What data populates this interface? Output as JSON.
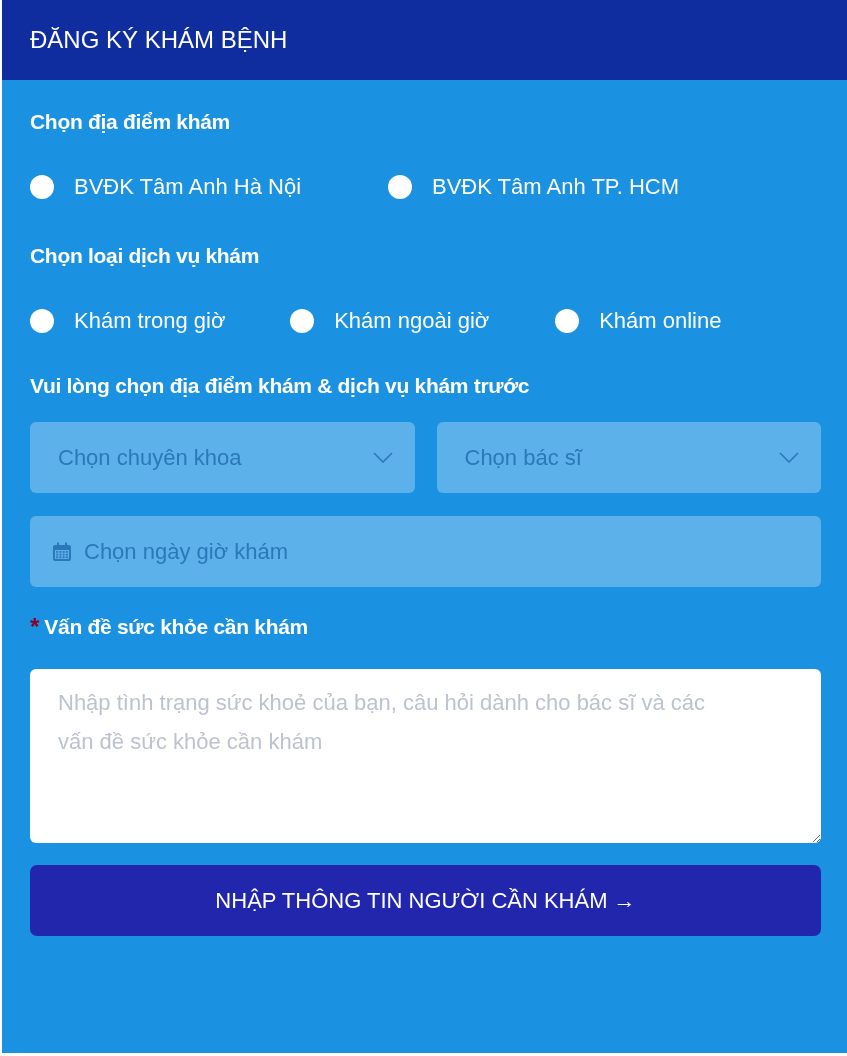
{
  "header": {
    "title": "ĐĂNG KÝ KHÁM BỆNH"
  },
  "location": {
    "label": "Chọn địa điểm khám",
    "options": [
      {
        "label": "BVĐK Tâm Anh Hà Nội",
        "selected": false
      },
      {
        "label": "BVĐK Tâm Anh TP. HCM",
        "selected": false
      }
    ]
  },
  "service": {
    "label": "Chọn loại dịch vụ khám",
    "options": [
      {
        "label": "Khám trong giờ",
        "selected": false
      },
      {
        "label": "Khám ngoài giờ",
        "selected": false
      },
      {
        "label": "Khám online",
        "selected": false
      }
    ]
  },
  "notice": "Vui lòng chọn địa điểm khám & dịch vụ khám trước",
  "selects": [
    {
      "placeholder": "Chọn chuyên khoa"
    },
    {
      "placeholder": "Chọn bác sĩ"
    }
  ],
  "date": {
    "placeholder": "Chọn ngày giờ khám"
  },
  "problem": {
    "required_mark": "*",
    "label": "Vấn đề sức khỏe cần khám",
    "placeholder": "Nhập tình trạng sức khoẻ của bạn, câu hỏi dành cho bác sĩ và các vấn đề sức khỏe cần khám"
  },
  "submit": "NHẬP THÔNG TIN NGƯỜI CẦN KHÁM →"
}
